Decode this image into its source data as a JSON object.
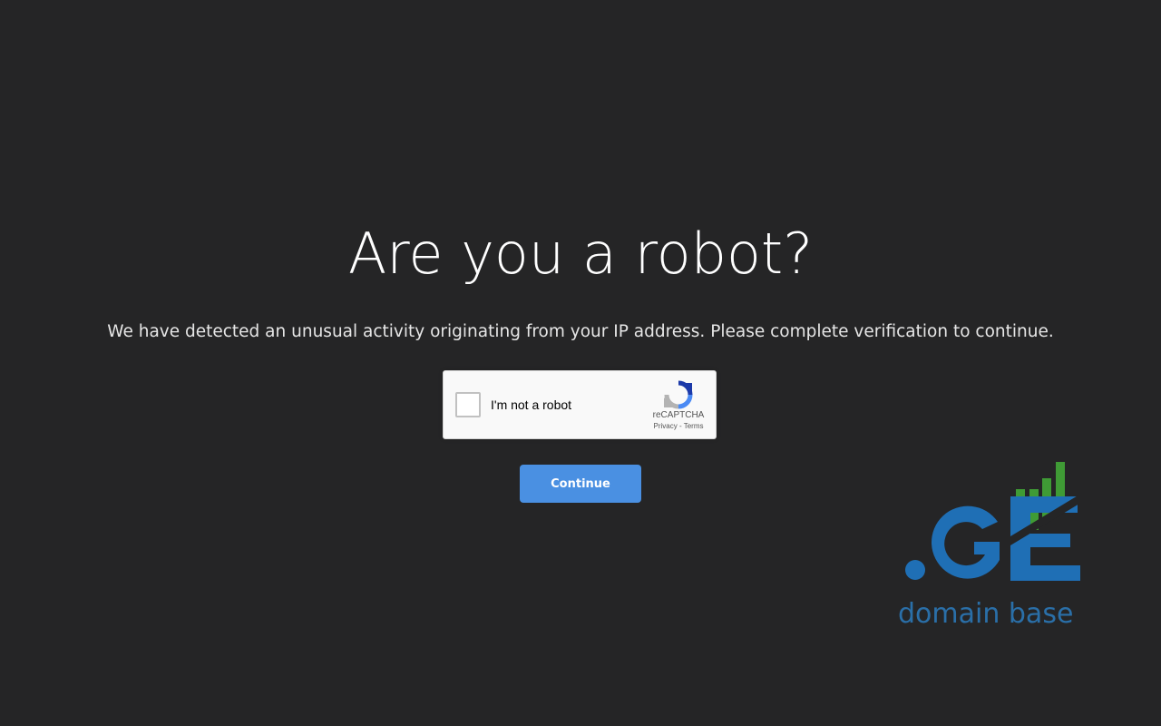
{
  "page": {
    "title": "Are you a robot?",
    "message": "We have detected an unusual activity originating from your IP address. Please complete verification to continue."
  },
  "recaptcha": {
    "checkbox_label": "I'm not a robot",
    "brand": "reCAPTCHA",
    "privacy_link": "Privacy",
    "separator": " - ",
    "terms_link": "Terms",
    "checked": false,
    "logo_icon": "recaptcha-logo-icon"
  },
  "actions": {
    "continue_label": "Continue"
  },
  "brand_logo": {
    "mark": ".GE",
    "tagline": "domain base",
    "icon": "bar-chart-icon"
  },
  "colors": {
    "background": "#252526",
    "button": "#4a90e2",
    "logo_blue": "#1f6fb5",
    "logo_green": "#3f9b35"
  }
}
